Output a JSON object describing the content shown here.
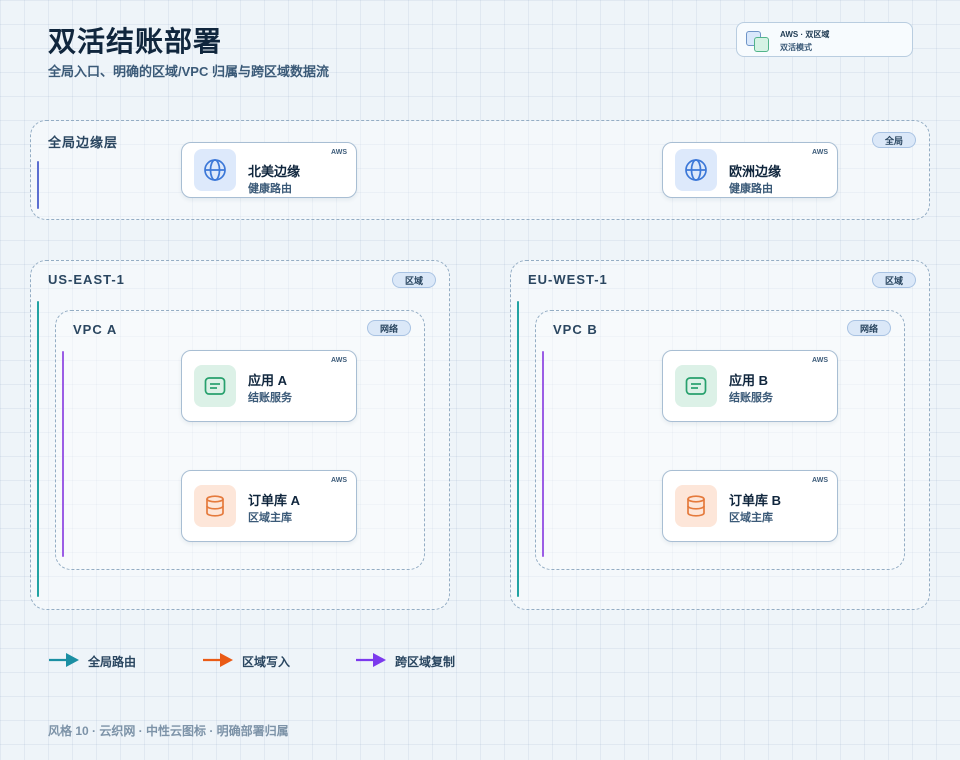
{
  "header": {
    "title": "双活结账部署",
    "subtitle": "全局入口、明确的区域/VPC 归属与跨区域数据流"
  },
  "badge": {
    "line1": "AWS · 双区域",
    "line2": "双活模式"
  },
  "global_zone": {
    "label": "全局边缘层",
    "tag": "全局",
    "cards": [
      {
        "name": "北美边缘",
        "sub": "健康路由",
        "provider": "AWS",
        "icon": "globe-icon"
      },
      {
        "name": "欧洲边缘",
        "sub": "健康路由",
        "provider": "AWS",
        "icon": "globe-icon"
      }
    ]
  },
  "regions": [
    {
      "label": "US-EAST-1",
      "tag": "区域",
      "vpc": {
        "label": "VPC A",
        "tag": "网络",
        "app": {
          "name": "应用 A",
          "sub": "结账服务",
          "provider": "AWS",
          "icon": "app-service-icon"
        },
        "db": {
          "name": "订单库 A",
          "sub": "区域主库",
          "provider": "AWS",
          "icon": "database-icon"
        }
      }
    },
    {
      "label": "EU-WEST-1",
      "tag": "区域",
      "vpc": {
        "label": "VPC B",
        "tag": "网络",
        "app": {
          "name": "应用 B",
          "sub": "结账服务",
          "provider": "AWS",
          "icon": "app-service-icon"
        },
        "db": {
          "name": "订单库 B",
          "sub": "区域主库",
          "provider": "AWS",
          "icon": "database-icon"
        }
      }
    }
  ],
  "legend": [
    {
      "label": "全局路由",
      "color": "#1b8fa3"
    },
    {
      "label": "区域写入",
      "color": "#ea5b16"
    },
    {
      "label": "跨区域复制",
      "color": "#7c3aed"
    }
  ],
  "footer": "风格 10 · 云织网 · 中性云图标 · 明确部署归属",
  "colors": {
    "global_edge_line": "#5b6fd1",
    "region_line": "#22a3a3",
    "vpc_line": "#9b5de5",
    "app_icon": "#27a06d",
    "db_icon": "#e57a3c",
    "globe_icon": "#3c78d8"
  }
}
